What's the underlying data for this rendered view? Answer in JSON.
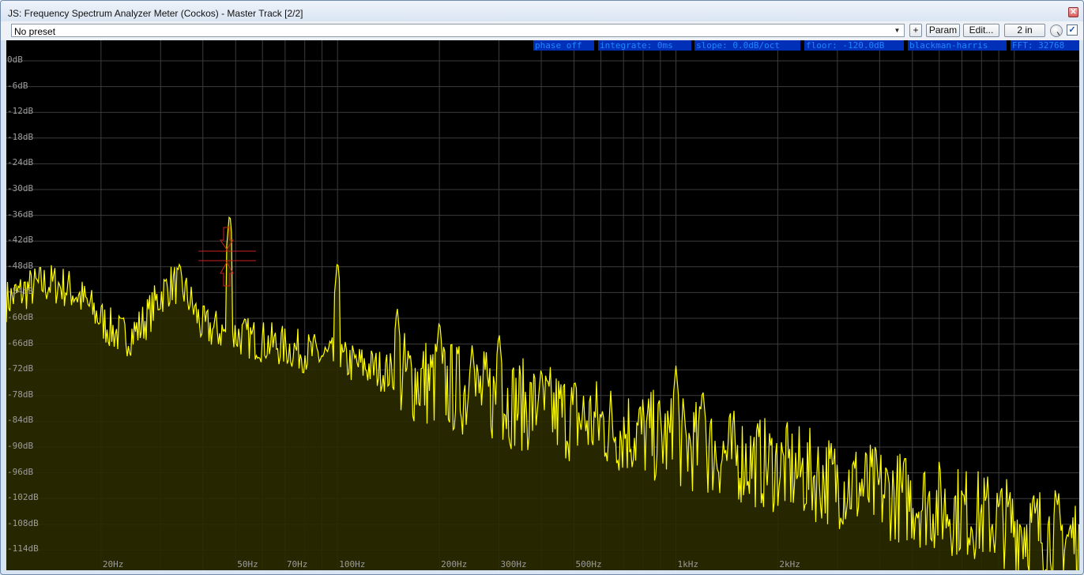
{
  "window": {
    "title": "JS: Frequency Spectrum Analyzer Meter (Cockos) - Master Track [2/2]"
  },
  "toolbar": {
    "preset": "No preset",
    "add_label": "+",
    "param_label": "Param",
    "edit_label": "Edit...",
    "io_label": "2 in"
  },
  "status": {
    "phase": "phase off",
    "integrate": "integrate: 0ms",
    "slope": "slope: 0.0dB/oct",
    "floor": "floor: -120.0dB",
    "window": "blackman-harris",
    "fft": "FFT: 32768"
  },
  "analyzer": {
    "db_labels": [
      "0dB",
      "-6dB",
      "-12dB",
      "-18dB",
      "-24dB",
      "-30dB",
      "-36dB",
      "-42dB",
      "-48dB",
      "-54dB",
      "-60dB",
      "-66dB",
      "-72dB",
      "-78dB",
      "-84dB",
      "-90dB",
      "-96dB",
      "-102dB",
      "-108dB",
      "-114dB"
    ],
    "freq_labels": [
      "20Hz",
      "50Hz",
      "70Hz",
      "100Hz",
      "200Hz",
      "300Hz",
      "500Hz",
      "1kHz",
      "2kHz"
    ],
    "colors": {
      "spectrum": "#ffff00",
      "fill": "#2a2a00",
      "grid": "#3c3c3c",
      "label": "#9b9b9b",
      "status_bg": "#0030b8",
      "status_text": "#1f86ff",
      "marker": "#cc2020"
    }
  }
}
